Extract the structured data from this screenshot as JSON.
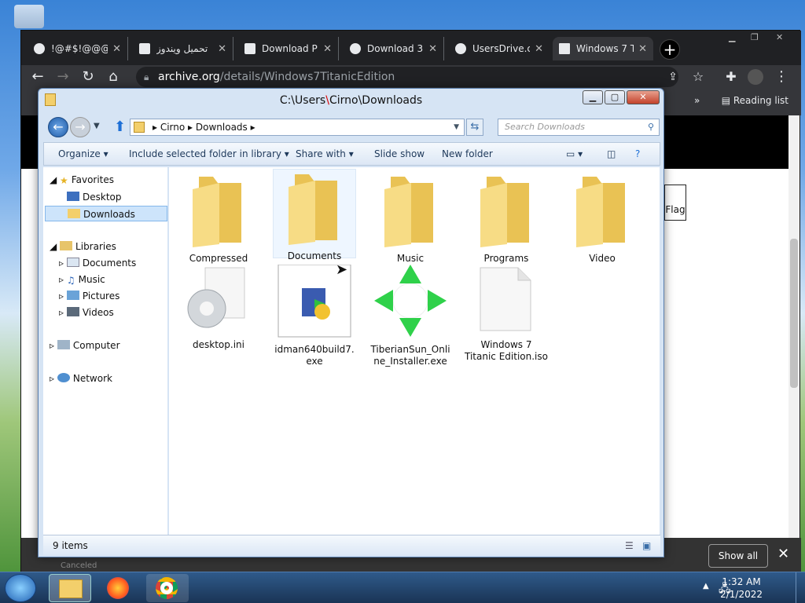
{
  "chrome": {
    "tabs": [
      {
        "label": "!@#$!@@@"
      },
      {
        "label": "تحميل ويندوز"
      },
      {
        "label": "Download P"
      },
      {
        "label": "Download 3"
      },
      {
        "label": "UsersDrive.c"
      },
      {
        "label": "Windows 7 T"
      }
    ],
    "new_tab": "+",
    "url_host": "archive.org",
    "url_path": "/details/Windows7TitanicEdition",
    "bookmarks_more": "»",
    "reading_list": "Reading list",
    "flag_label": "Flag",
    "download_status": "Canceled",
    "show_all": "Show all",
    "close": "✕"
  },
  "explorer": {
    "title_prefix": "C:\\Users",
    "title_sep": "\\",
    "title_suffix": "Cirno\\Downloads",
    "breadcrumb": [
      "Cirno",
      "Downloads"
    ],
    "search_placeholder": "Search Downloads",
    "commands": {
      "organize": "Organize",
      "include": "Include selected folder in library",
      "share": "Share with",
      "slideshow": "Slide show",
      "newfolder": "New folder"
    },
    "nav": {
      "favorites": "Favorites",
      "desktop": "Desktop",
      "downloads": "Downloads",
      "libraries": "Libraries",
      "documents": "Documents",
      "music": "Music",
      "pictures": "Pictures",
      "videos": "Videos",
      "computer": "Computer",
      "network": "Network"
    },
    "items": [
      {
        "label": "Compressed"
      },
      {
        "label": "Documents"
      },
      {
        "label": "Music"
      },
      {
        "label": "Programs"
      },
      {
        "label": "Video"
      },
      {
        "label": "desktop.ini"
      },
      {
        "label": "idman640build7.exe"
      },
      {
        "label": "TiberianSun_Online_Installer.exe"
      },
      {
        "label": "Windows 7 Titanic Edition.iso"
      }
    ],
    "status": "9 items"
  },
  "taskbar": {
    "time": "1:32 AM",
    "date": "2/1/2022"
  },
  "colors": {
    "chrome_dark": "#202124",
    "explorer_frame": "#d6e4f4",
    "selection": "#cde4fb",
    "folder": "#f3cf6b"
  }
}
